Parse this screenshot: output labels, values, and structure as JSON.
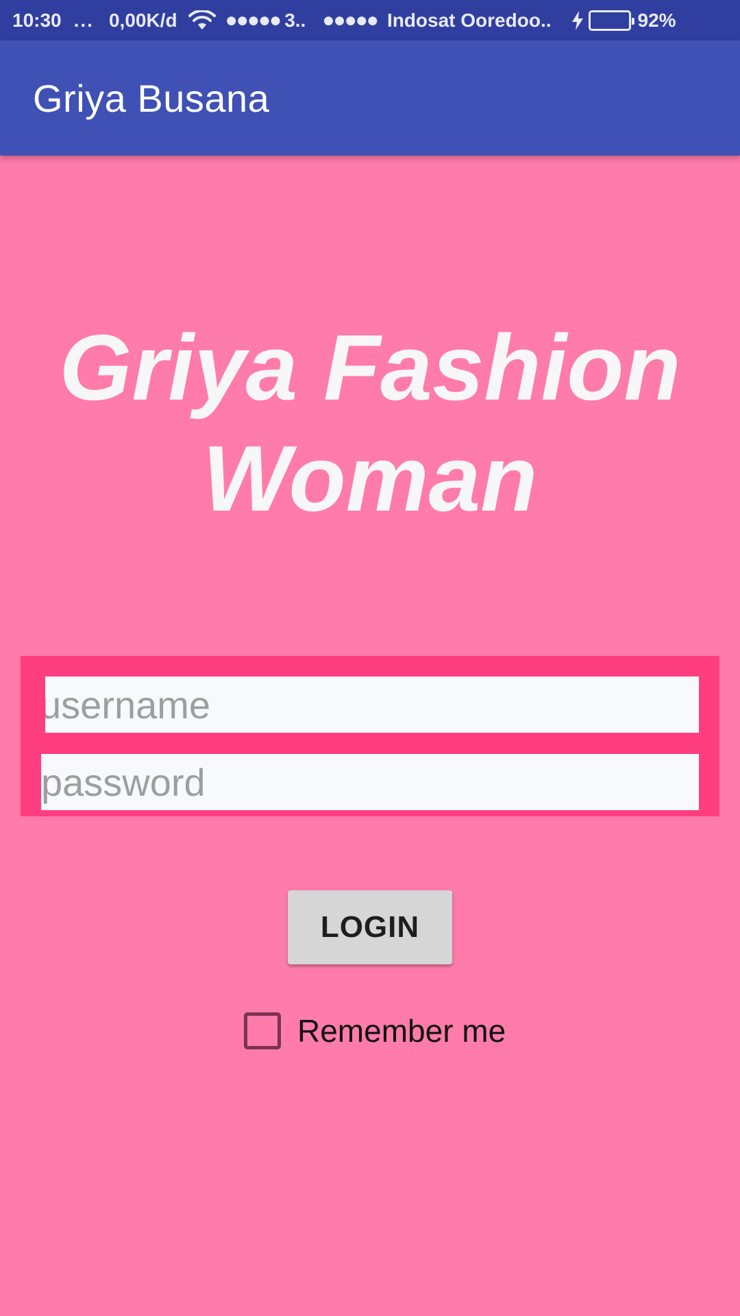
{
  "status_bar": {
    "time": "10:30",
    "more_indicator": "...",
    "network_speed": "0,00K/d",
    "wifi_icon": "wifi-icon",
    "signal_1": "●●●●●",
    "network_type": "3..",
    "signal_2": "●●●●●",
    "carrier": "Indosat Ooredoo..",
    "charging_icon": "lightning-bolt-icon",
    "battery_icon": "battery-icon",
    "battery_level": 0.92,
    "battery_color": "#76E020",
    "battery_percent": "92%"
  },
  "app_bar": {
    "title": "Griya Busana",
    "color": "#3F51B5"
  },
  "brand": {
    "line1": "Griya Fashion",
    "line2": "Woman"
  },
  "form": {
    "username_placeholder": "username",
    "username_value": "",
    "password_placeholder": "password",
    "password_value": ""
  },
  "login_button": {
    "label": "LOGIN"
  },
  "remember_me": {
    "label": "Remember me",
    "checked": false
  },
  "colors": {
    "background": "#FF7BAA",
    "form_box": "#FF3E7F",
    "status_bar": "#303F9F"
  }
}
